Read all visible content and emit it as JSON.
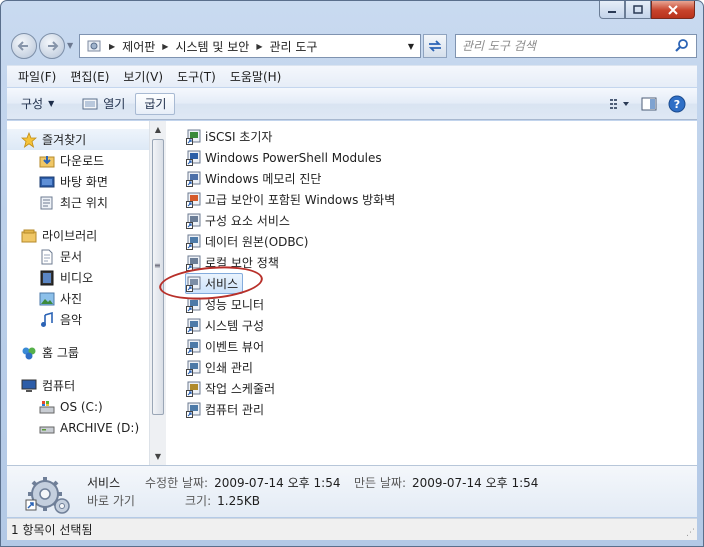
{
  "window": {
    "caption_buttons": [
      "minimize",
      "maximize",
      "close"
    ]
  },
  "address_bar": {
    "breadcrumbs": [
      "제어판",
      "시스템 및 보안",
      "관리 도구"
    ]
  },
  "search": {
    "placeholder": "관리 도구 검색"
  },
  "menu": {
    "items": [
      "파일(F)",
      "편집(E)",
      "보기(V)",
      "도구(T)",
      "도움말(H)"
    ]
  },
  "commands": {
    "organize": "구성",
    "open": "열기",
    "burn": "굽기"
  },
  "nav_pane": {
    "favorites": {
      "label": "즐겨찾기",
      "items": [
        "다운로드",
        "바탕 화면",
        "최근 위치"
      ]
    },
    "libraries": {
      "label": "라이브러리",
      "items": [
        "문서",
        "비디오",
        "사진",
        "음악"
      ]
    },
    "homegroup": "홈 그룹",
    "computer": {
      "label": "컴퓨터",
      "items": [
        "OS (C:)",
        "ARCHIVE (D:)"
      ]
    }
  },
  "files": [
    "iSCSI 초기자",
    "Windows PowerShell Modules",
    "Windows 메모리 진단",
    "고급 보안이 포함된 Windows 방화벽",
    "구성 요소 서비스",
    "데이터 원본(ODBC)",
    "로컬 보안 정책",
    "서비스",
    "성능 모니터",
    "시스템 구성",
    "이벤트 뷰어",
    "인쇄 관리",
    "작업 스케줄러",
    "컴퓨터 관리"
  ],
  "selected_index": 7,
  "details": {
    "name": "서비스",
    "type": "바로 가기",
    "modified_label": "수정한 날짜:",
    "modified_value": "2009-07-14 오후 1:54",
    "created_label": "만든 날짜:",
    "created_value": "2009-07-14 오후 1:54",
    "size_label": "크기:",
    "size_value": "1.25KB"
  },
  "status": {
    "text": "1 항목이 선택됨"
  },
  "colors": {
    "accent": "#2b63b5",
    "selection_border": "#84acdd",
    "annotation_ring": "#b8302a"
  }
}
